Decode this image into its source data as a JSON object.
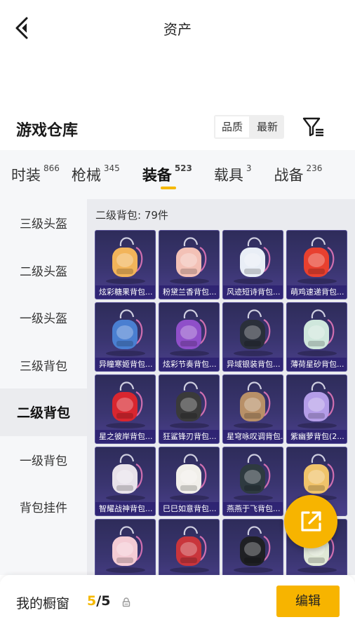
{
  "header": {
    "title": "资产"
  },
  "section": {
    "title": "游戏仓库",
    "sort_options": [
      "品质",
      "最新"
    ],
    "active_sort": "品质"
  },
  "tabs": [
    {
      "label": "时装",
      "count": "866"
    },
    {
      "label": "枪械",
      "count": "345"
    },
    {
      "label": "装备",
      "count": "523",
      "active": true
    },
    {
      "label": "载具",
      "count": "3"
    },
    {
      "label": "战备",
      "count": "236"
    }
  ],
  "sidebar": {
    "items": [
      "三级头盔",
      "二级头盔",
      "一级头盔",
      "三级背包",
      "二级背包",
      "一级背包",
      "背包挂件"
    ],
    "active_index": 4
  },
  "grid": {
    "caption": "二级背包: 79件",
    "items": [
      {
        "name": "炫彩糖果背包...",
        "icon": "candy-backpack-icon",
        "color": "#f2b45a"
      },
      {
        "name": "粉黛兰香背包...",
        "icon": "pink-backpack-icon",
        "color": "#f3c1b6"
      },
      {
        "name": "风迹短诗背包...",
        "icon": "poem-backpack-icon",
        "color": "#e9eef6"
      },
      {
        "name": "萌鸡速递背包...",
        "icon": "chick-backpack-icon",
        "color": "#e8402f"
      },
      {
        "name": "异瞳寒姬背包...",
        "icon": "ice-backpack-icon",
        "color": "#4a7fd1"
      },
      {
        "name": "炫彩节奏背包...",
        "icon": "rhythm-backpack-icon",
        "color": "#8f4fc9"
      },
      {
        "name": "异域银装背包...",
        "icon": "silver-backpack-icon",
        "color": "#2a2f3a"
      },
      {
        "name": "薄荷星砂背包...",
        "icon": "mint-backpack-icon",
        "color": "#cfe7dc"
      },
      {
        "name": "星之彼岸背包...",
        "icon": "star-backpack-icon",
        "color": "#d8262f"
      },
      {
        "name": "狂鲨锋刃背包...",
        "icon": "shark-backpack-icon",
        "color": "#3a3a3a"
      },
      {
        "name": "星穹咏叹调背包...",
        "icon": "aria-backpack-icon",
        "color": "#b89068"
      },
      {
        "name": "紫幽萝背包(2...",
        "icon": "violet-backpack-icon",
        "color": "#b49de8"
      },
      {
        "name": "智耀战神背包...",
        "icon": "wisdom-backpack-icon",
        "color": "#e8e2ea"
      },
      {
        "name": "巳巳如意背包...",
        "icon": "snake-backpack-icon",
        "color": "#f1efea"
      },
      {
        "name": "燕燕于飞背包...",
        "icon": "swallow-backpack-icon",
        "color": "#2e3a40"
      },
      {
        "name": "",
        "icon": "cartoon-backpack-icon",
        "color": "#f0c36a"
      },
      {
        "name": "",
        "icon": "sakura-backpack-icon",
        "color": "#f4cbd4"
      },
      {
        "name": "",
        "icon": "lantern-backpack-icon",
        "color": "#c9353c"
      },
      {
        "name": "",
        "icon": "cat-backpack-icon",
        "color": "#1f2024"
      },
      {
        "name": "",
        "icon": "jade-backpack-icon",
        "color": "#e0e8d6"
      }
    ]
  },
  "bottom": {
    "label": "我的橱窗",
    "used": "5",
    "slash": "/",
    "total": "5",
    "edit_label": "编辑"
  },
  "colors": {
    "accent": "#f7b400",
    "card_bg": "#3a3570"
  }
}
